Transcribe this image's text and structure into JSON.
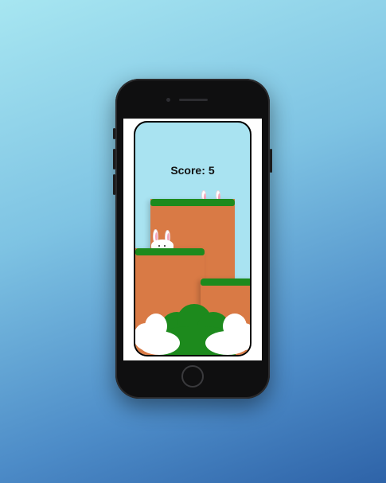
{
  "game": {
    "score_label": "Score:",
    "score_value": "5"
  },
  "colors": {
    "sky": "#a9e3f1",
    "grass": "#1d8a1d",
    "dirt": "#d97a45",
    "cloud": "#ffffff"
  },
  "device": {
    "icons": [
      "camera-icon",
      "speaker-icon",
      "home-button"
    ]
  }
}
